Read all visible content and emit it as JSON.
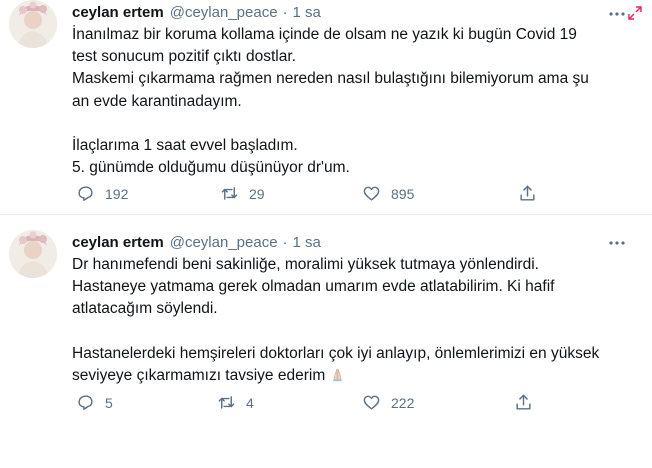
{
  "tweets": [
    {
      "author_name": "ceylan ertem",
      "handle": "@ceylan_peace",
      "separator": "·",
      "time": "1 sa",
      "paragraphs": [
        [
          "İnanılmaz bir koruma kollama içinde de olsam ne yazık ki bugün Covid 19",
          "test sonucum pozitif çıktı dostlar.",
          "Maskemi çıkarmama rağmen nereden nasıl bulaştığını bilemiyorum ama şu",
          "an evde karantinadayım."
        ],
        [
          "İlaçlarıma 1 saat evvel başladım.",
          "5. günümde olduğumu düşünüyor dr'um."
        ]
      ],
      "replies": "192",
      "retweets": "29",
      "likes": "895"
    },
    {
      "author_name": "ceylan ertem",
      "handle": "@ceylan_peace",
      "separator": "·",
      "time": "1 sa",
      "paragraphs": [
        [
          "Dr hanımefendi beni sakinliğe, moralimi yüksek tutmaya yönlendirdi.",
          "Hastaneye yatmama gerek olmadan umarım evde atlatabilirim. Ki hafif",
          "atlatacağım söylendi."
        ],
        [
          "Hastanelerdeki hemşireleri doktorları çok iyi anlayıp, önlemlerimizi en yüksek",
          "seviyeye çıkarmamızı tavsiye ederim"
        ]
      ],
      "emoji": "folded-hands-emoji",
      "replies": "5",
      "retweets": "4",
      "likes": "222"
    }
  ],
  "colors": {
    "text": "#0f1419",
    "secondary": "#5b7083",
    "divider": "#e6ecf0",
    "expand_icon": "#e0245e"
  },
  "icons": [
    "more-icon",
    "expand-icon",
    "reply-icon",
    "retweet-icon",
    "like-icon",
    "share-icon"
  ]
}
